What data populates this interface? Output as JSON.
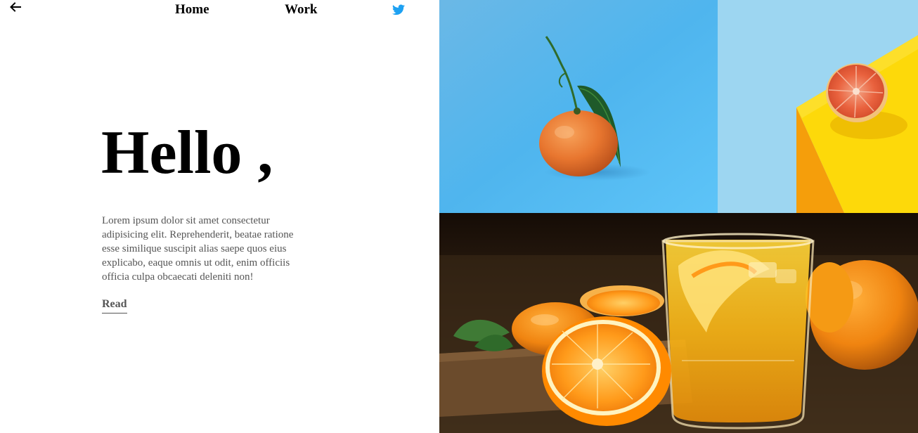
{
  "nav": {
    "back_icon": "arrow-left-icon",
    "home_label": "Home",
    "work_label": "Work",
    "social_icon": "twitter-icon",
    "social_color": "#1DA1F2"
  },
  "hero": {
    "title": "Hello ,",
    "body": "Lorem ipsum dolor sit amet consectetur adipisicing elit. Reprehenderit, beatae ratione esse similique suscipit alias saepe quos eius explicabo, eaque omnis ut odit, enim officiis officia culpa obcaecati deleniti non!",
    "read_label": "Read"
  },
  "gallery": {
    "images": [
      {
        "subject": "tangerine-with-leaf-on-blue"
      },
      {
        "subject": "grapefruit-half-on-yellow-block"
      },
      {
        "subject": "orange-juice-glass-with-oranges"
      }
    ]
  }
}
